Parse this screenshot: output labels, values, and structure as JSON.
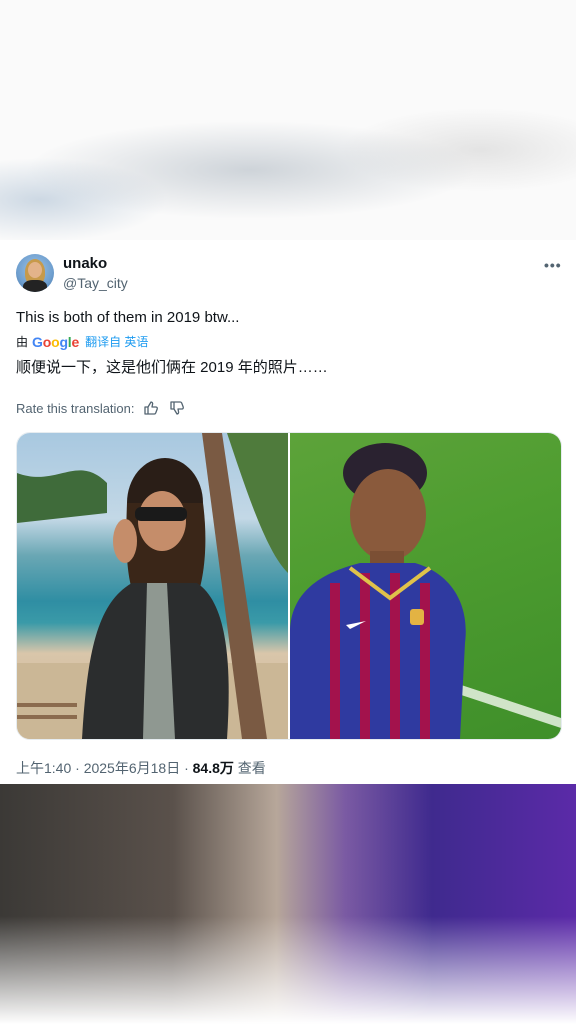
{
  "tweet": {
    "author_name": "unako",
    "author_handle": "@Tay_city",
    "more_label": "•••",
    "text": "This is both of them in 2019 btw...",
    "translation": {
      "by_prefix": "由",
      "provider_letters": [
        "G",
        "o",
        "o",
        "g",
        "l",
        "e"
      ],
      "translated_from_label": "翻译自 英语",
      "translated_text": "顺便说一下，这是他们俩在 2019 年的照片……",
      "rate_label": "Rate this translation:"
    },
    "timestamp": "上午1:40 · 2025年6月18日 · ",
    "views": "84.8万",
    "views_suffix": " 查看"
  },
  "colors": {
    "text_primary": "#0f1419",
    "text_secondary": "#536471",
    "link_blue": "#1d9bf0"
  },
  "icons": [
    "thumbs-up-icon",
    "thumbs-down-icon",
    "more-icon"
  ]
}
